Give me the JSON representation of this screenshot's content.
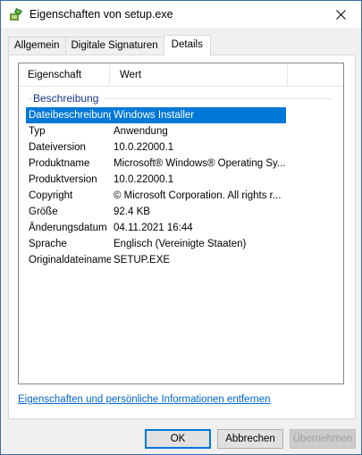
{
  "window": {
    "title": "Eigenschaften von setup.exe",
    "icon": "installer-icon",
    "close_icon": "close-icon"
  },
  "tabs": [
    {
      "label": "Allgemein",
      "active": false
    },
    {
      "label": "Digitale Signaturen",
      "active": false
    },
    {
      "label": "Details",
      "active": true
    }
  ],
  "listview": {
    "columns": [
      "Eigenschaft",
      "Wert"
    ],
    "group": "Beschreibung",
    "rows": [
      {
        "property": "Dateibeschreibung",
        "value": "Windows Installer",
        "selected": true
      },
      {
        "property": "Typ",
        "value": "Anwendung",
        "selected": false
      },
      {
        "property": "Dateiversion",
        "value": "10.0.22000.1",
        "selected": false
      },
      {
        "property": "Produktname",
        "value": "Microsoft® Windows® Operating Sy...",
        "selected": false
      },
      {
        "property": "Produktversion",
        "value": "10.0.22000.1",
        "selected": false
      },
      {
        "property": "Copyright",
        "value": "© Microsoft Corporation. All rights r...",
        "selected": false
      },
      {
        "property": "Größe",
        "value": "92.4 KB",
        "selected": false
      },
      {
        "property": "Änderungsdatum",
        "value": "04.11.2021 16:44",
        "selected": false
      },
      {
        "property": "Sprache",
        "value": "Englisch (Vereinigte Staaten)",
        "selected": false
      },
      {
        "property": "Originaldateiname",
        "value": "SETUP.EXE",
        "selected": false
      }
    ]
  },
  "link": "Eigenschaften und persönliche Informationen entfernen",
  "buttons": {
    "ok": "OK",
    "cancel": "Abbrechen",
    "apply": "Übernehmen"
  },
  "colors": {
    "selection": "#0078d7",
    "link": "#0066cc",
    "group_header": "#1e3287",
    "accent_border": "#3a6ea5"
  }
}
